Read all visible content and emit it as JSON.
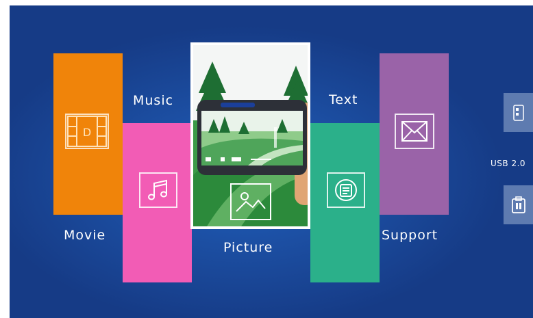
{
  "menu": {
    "movie": {
      "label": "Movie",
      "color": "#f0840a",
      "icon": "film-icon"
    },
    "music": {
      "label": "Music",
      "color": "#f25cb5",
      "icon": "music-note-icon"
    },
    "picture": {
      "label": "Picture",
      "color": "#2a8f3a",
      "icon": "image-icon"
    },
    "text": {
      "label": "Text",
      "color": "#2bb08a",
      "icon": "document-icon"
    },
    "support": {
      "label": "Support",
      "color": "#9a63a8",
      "icon": "envelope-icon"
    }
  },
  "sidebar": {
    "usb_label": "USB 2.0",
    "top_button_icon": "usb-device-icon",
    "bottom_button_icon": "usb-drive-icon",
    "button_color": "#5e7bb0"
  },
  "background_color": "#1c4fa3"
}
